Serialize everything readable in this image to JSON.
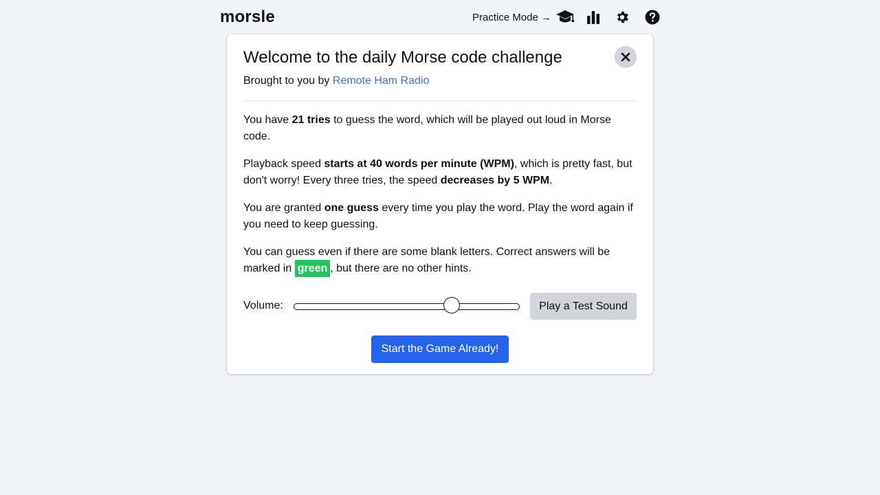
{
  "app": {
    "logo": "morsle"
  },
  "nav": {
    "practice_label": "Practice Mode →",
    "icons": [
      "graduation-cap-icon",
      "bar-chart-icon",
      "gear-icon",
      "help-icon"
    ]
  },
  "modal": {
    "title": "Welcome to the daily Morse code challenge",
    "subtitle_prefix": "Brought to you by ",
    "subtitle_link": "Remote Ham Radio",
    "paragraphs": {
      "p1": {
        "a": "You have ",
        "b": "21 tries",
        "c": " to guess the word, which will be played out loud in Morse code."
      },
      "p2": {
        "a": "Playback speed ",
        "b": "starts at 40 words per minute (WPM)",
        "c": ", which is pretty fast, but don't worry! Every three tries, the speed ",
        "d": "decreases by 5 WPM",
        "e": "."
      },
      "p3": {
        "a": "You are granted ",
        "b": "one guess",
        "c": " every time you play the word. Play the word again if you need to keep guessing."
      },
      "p4": {
        "a": "You can guess even if there are some blank letters. Correct answers will be marked in ",
        "b": "green",
        "c": ", but there are no other hints."
      }
    },
    "volume_label": "Volume:",
    "volume_value": 0.7,
    "test_button": "Play a Test Sound",
    "start_button": "Start the Game Already!"
  },
  "colors": {
    "background": "#f3f4f6",
    "link": "#3b6fd8",
    "highlight_green": "#22c55e",
    "primary_button": "#2563eb",
    "secondary_button": "#d1d5db"
  }
}
